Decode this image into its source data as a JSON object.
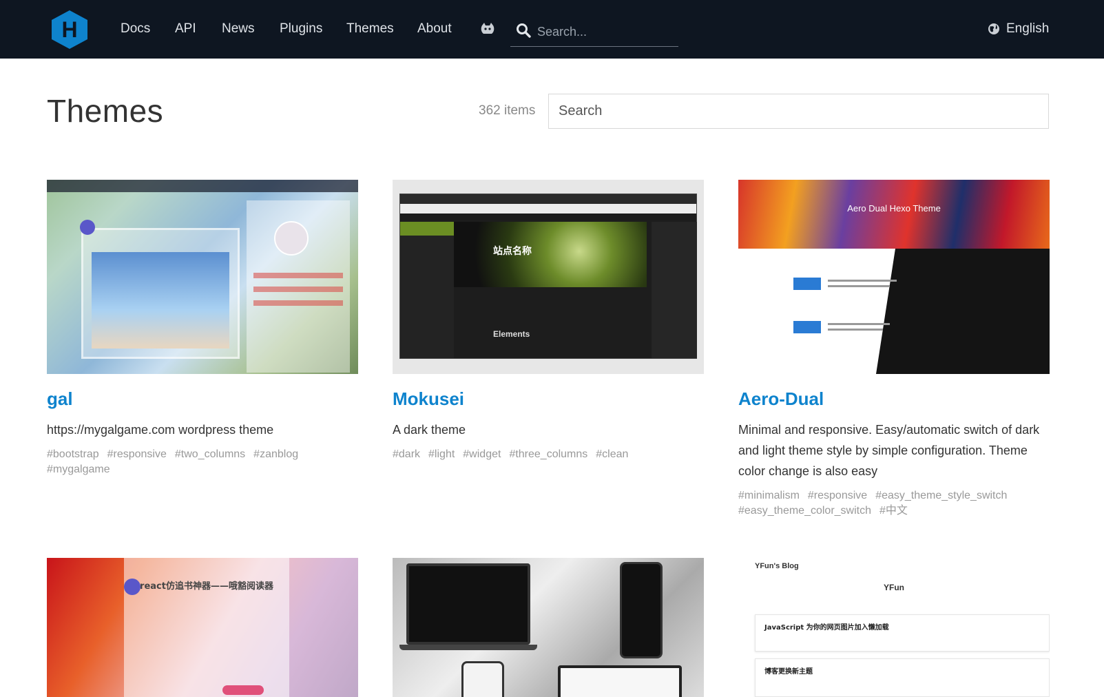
{
  "header": {
    "logo_letter": "H",
    "nav": [
      {
        "label": "Docs"
      },
      {
        "label": "API"
      },
      {
        "label": "News"
      },
      {
        "label": "Plugins"
      },
      {
        "label": "Themes"
      },
      {
        "label": "About"
      }
    ],
    "search_placeholder": "Search...",
    "language": "English"
  },
  "page": {
    "title": "Themes",
    "items_count": "362 items",
    "search_placeholder": "Search"
  },
  "themes": [
    {
      "name": "gal",
      "description": "https://mygalgame.com wordpress theme",
      "tags": [
        "#bootstrap",
        "#responsive",
        "#two_columns",
        "#zanblog",
        "#mygalgame"
      ]
    },
    {
      "name": "Mokusei",
      "description": "A dark theme",
      "tags": [
        "#dark",
        "#light",
        "#widget",
        "#three_columns",
        "#clean"
      ]
    },
    {
      "name": "Aero-Dual",
      "description": "Minimal and responsive. Easy/automatic switch of dark and light theme style by simple configuration. Theme color change is also easy",
      "tags": [
        "#minimalism",
        "#responsive",
        "#easy_theme_style_switch",
        "#easy_theme_color_switch",
        "#中文"
      ]
    }
  ],
  "thumb_text": {
    "mokusei_site": "站点名称",
    "mokusei_post": "Elements",
    "aero_title": "Aero Dual Hexo Theme",
    "reader_title": "react仿追书神器——哦豁阅读器",
    "yfun_brand": "YFun's Blog",
    "yfun_name": "YFun",
    "yfun_post1": "JavaScript 为你的网页图片加入懒加载",
    "yfun_post2": "博客更换新主题"
  },
  "colors": {
    "header_bg": "#0e1621",
    "accent": "#0e83cd",
    "logo": "#0e83cd"
  }
}
